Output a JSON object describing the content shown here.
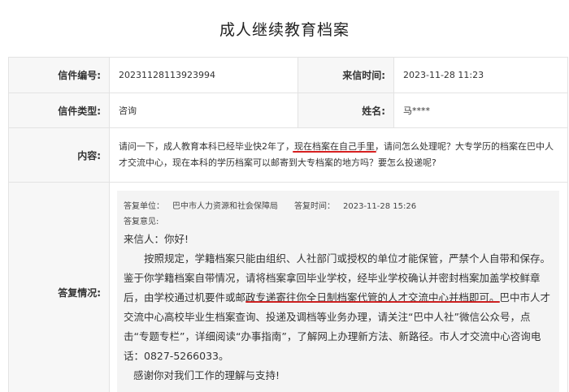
{
  "page_title": "成人继续教育档案",
  "record": {
    "letter_no_label": "信件编号:",
    "letter_no": "20231128113923994",
    "letter_time_label": "来信时间:",
    "letter_time": "2023-11-28 11:23",
    "letter_type_label": "信件类型:",
    "letter_type": "咨询",
    "name_label": "姓名:",
    "name": "马****",
    "content_label": "内容:",
    "content_part1": "请问一下，成人教育本科已经毕业快2年了，",
    "content_highlight": "现在档案在自己手里",
    "content_part2": "，请问怎么处理呢？大专学历的档案在巴中人才交流中心，现在本科的学历档案可以邮寄到大专档案的地方吗？要怎么投递呢?",
    "reply_label": "答复情况:"
  },
  "reply": {
    "unit_label": "答复单位：",
    "unit": "巴中市人力资源和社会保障局",
    "time_label": "答复时间：",
    "time": "2023-11-28 15:26",
    "opinion_label": "答复意见:",
    "greeting": "来信人：你好!",
    "body_part1": "按照规定，学籍档案只能由组织、人社部门或授权的单位才能保管，严禁个人自带和保存。鉴于你学籍档案自带情况，",
    "body_highlight": "请将档案拿回毕业学校，经毕业学校确认并密封档案加盖学校鲜章后，由学校通过机要件或邮政专递寄往你全日制档案代管的人才交流中心并档即可。",
    "body_part2": "巴中市人才交流中心高校毕业生档案查询、投递及调档等业务办理，请关注“巴中人社”微信公众号，点击“专题专栏”，详细阅读“办事指南”，了解网上办理新方法、新路径。市人才交流中心咨询电话：0827-5266033。",
    "thanks": "感谢你对我们工作的理解与支持!"
  },
  "colors": {
    "annotation_red": "#d62020",
    "label_bg": "#f7f7f7",
    "reply_bg": "#f4f4f4",
    "border": "#e3e3e3"
  }
}
